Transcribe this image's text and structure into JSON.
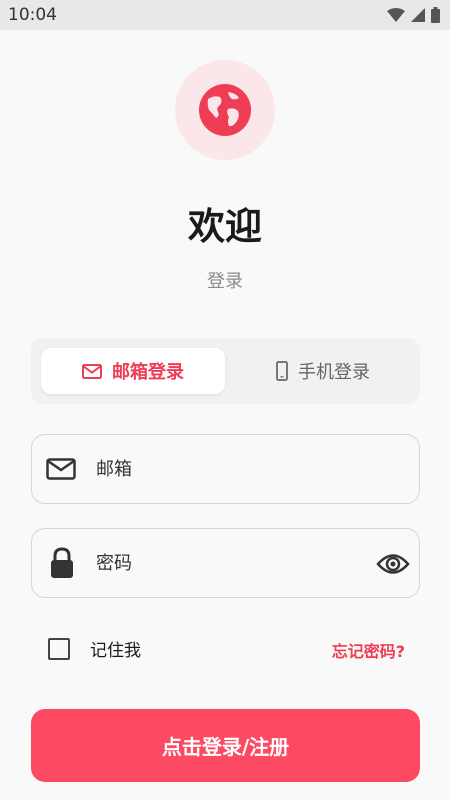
{
  "status_bar": {
    "time": "10:04"
  },
  "header": {
    "welcome": "欢迎",
    "subtitle": "登录"
  },
  "tabs": [
    {
      "label": "邮箱登录",
      "icon": "mail-icon",
      "active": true
    },
    {
      "label": "手机登录",
      "icon": "phone-icon",
      "active": false
    }
  ],
  "form": {
    "email_placeholder": "邮箱",
    "password_placeholder": "密码",
    "remember_label": "记住我",
    "forgot_label": "忘记密码?",
    "submit_label": "点击登录/注册"
  },
  "colors": {
    "accent": "#ef3d55",
    "button": "#fb4a62",
    "logo_bg": "#fbe6e9"
  }
}
